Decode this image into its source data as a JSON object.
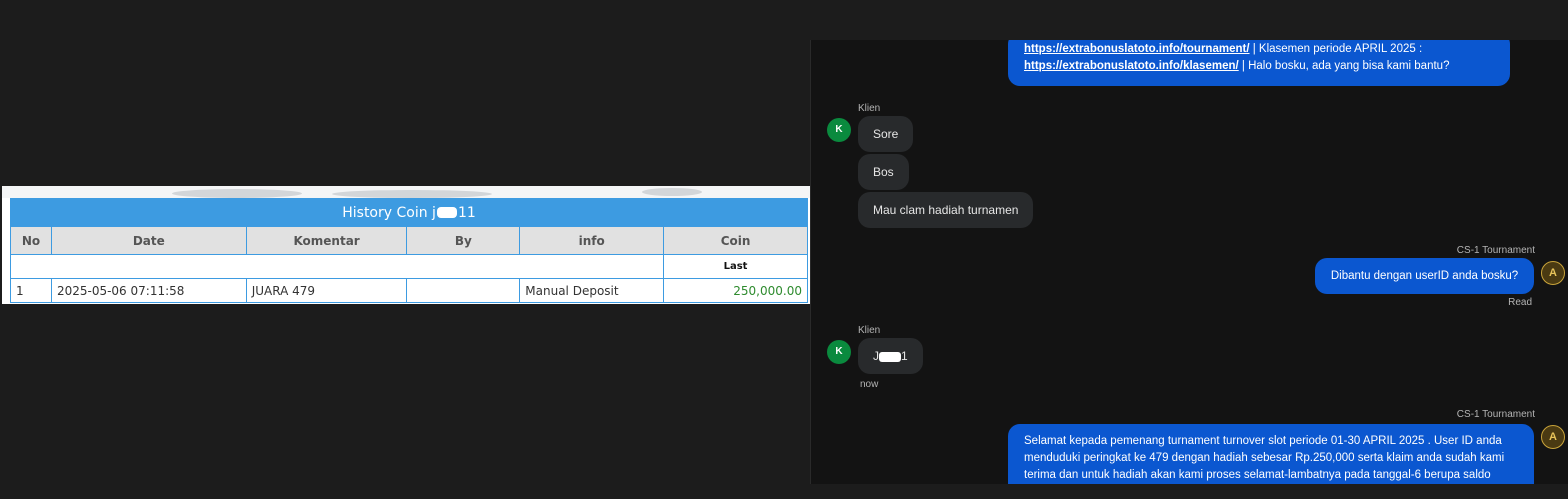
{
  "history": {
    "title_prefix": "History Coin j",
    "title_suffix": "11",
    "headers": [
      "No",
      "Date",
      "Komentar",
      "By",
      "info",
      "Coin"
    ],
    "last_label": "Last",
    "rows": [
      {
        "no": "1",
        "date": "2025-05-06 07:11:58",
        "komentar": "JUARA 479",
        "by": "",
        "info": "Manual Deposit",
        "coin": "250,000.00"
      }
    ],
    "colors": {
      "header_blue": "#3d9be1",
      "coin_green": "#2e8b2e"
    }
  },
  "chat": {
    "msg1": {
      "link1": "https://extrabonuslatoto.info/tournament/",
      "text1": " | Klasemen periode APRIL 2025 :",
      "link2": "https://extrabonuslatoto.info/klasemen/",
      "text2": " | Halo bosku, ada yang bisa kami bantu?"
    },
    "client_label": "Klien",
    "client_avatar": "K",
    "client_messages": [
      "Sore",
      "Bos",
      "Mau clam hadiah turnamen"
    ],
    "agent_label": "CS-1 Tournament",
    "agent_avatar": "A",
    "agent_msg2": "Dibantu dengan userID anda bosku?",
    "read_label": "Read",
    "client_reply_prefix": "J",
    "client_reply_suffix": "1",
    "now_label": "now",
    "agent_msg3": "Selamat kepada pemenang turnament turnover slot periode 01-30 APRIL 2025 . User ID anda menduduki peringkat ke 479 dengan hadiah sebesar Rp.250,000 serta klaim anda sudah kami terima dan untuk hadiah akan kami proses selamat-lambatnya pada tanggal-6 berupa saldo",
    "colors": {
      "agent_bubble": "#0b57d0",
      "client_bubble": "#282a2c",
      "client_avatar": "#0a8a3e"
    }
  }
}
